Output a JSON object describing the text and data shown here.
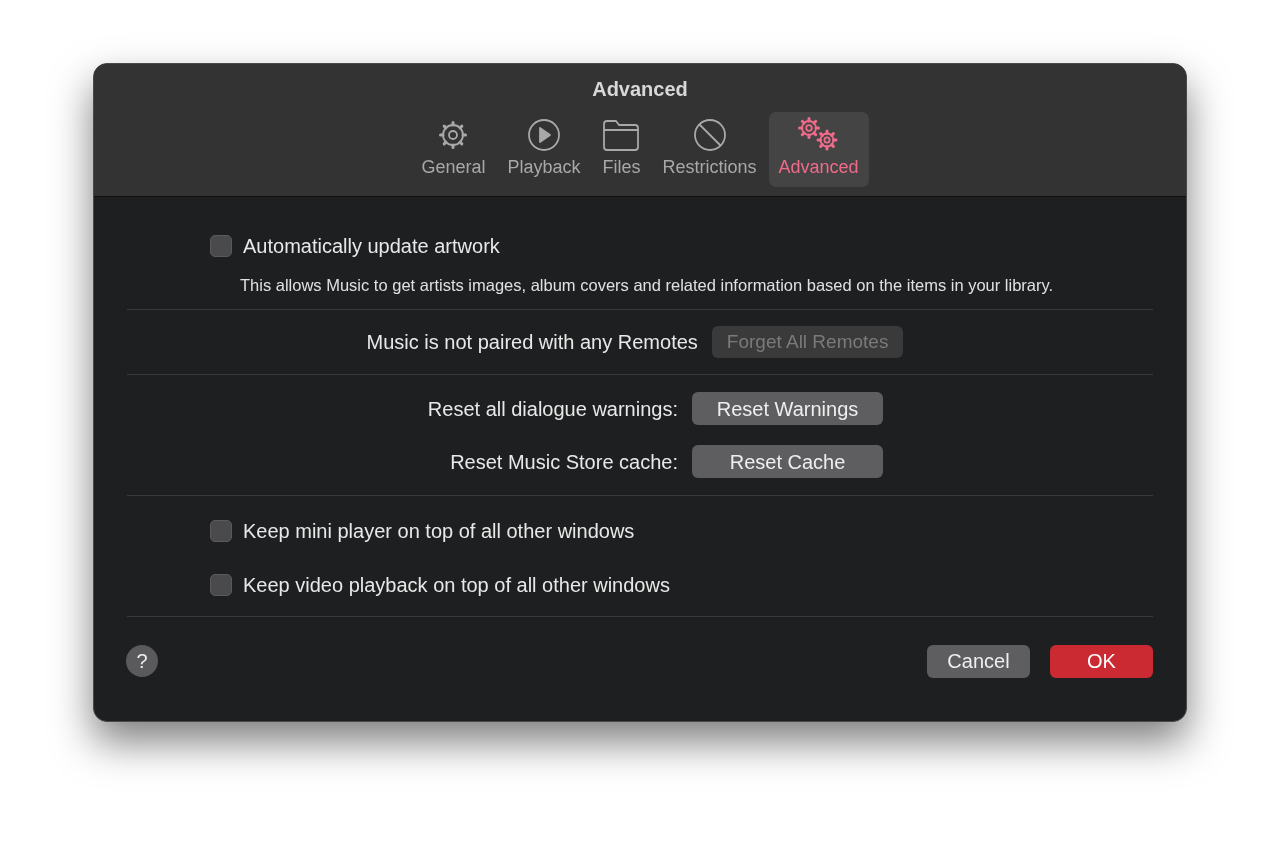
{
  "window": {
    "title": "Advanced"
  },
  "tabs": [
    {
      "label": "General",
      "kind": "gear",
      "selected": false
    },
    {
      "label": "Playback",
      "kind": "play",
      "selected": false
    },
    {
      "label": "Files",
      "kind": "folder",
      "selected": false
    },
    {
      "label": "Restrictions",
      "kind": "prohibited",
      "selected": false
    },
    {
      "label": "Advanced",
      "kind": "gears",
      "selected": true
    }
  ],
  "artwork": {
    "label": "Automatically update artwork",
    "checked": false,
    "description": "This allows Music to get artists images, album covers and related information based on the items in your library."
  },
  "remotes": {
    "label": "Music is not paired with any Remotes",
    "button": "Forget All Remotes",
    "disabled": true
  },
  "resets": [
    {
      "label": "Reset all dialogue warnings:",
      "button": "Reset Warnings"
    },
    {
      "label": "Reset Music Store cache:",
      "button": "Reset Cache"
    }
  ],
  "options": [
    {
      "label": "Keep mini player on top of all other windows",
      "checked": false
    },
    {
      "label": "Keep video playback on top of all other windows",
      "checked": false
    }
  ],
  "footer": {
    "help": "?",
    "cancel": "Cancel",
    "ok": "OK"
  }
}
